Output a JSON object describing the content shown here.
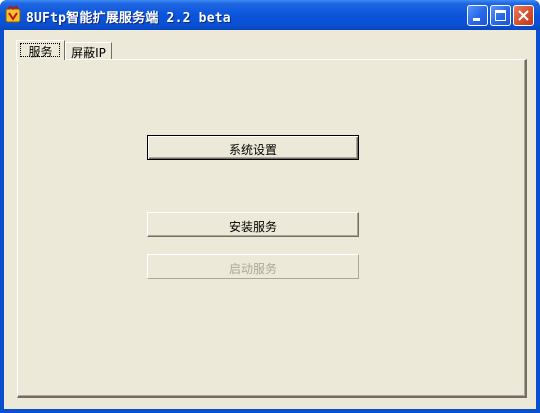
{
  "window": {
    "title": "8UFtp智能扩展服务端 2.2 beta",
    "icon": "app-icon",
    "controls": {
      "minimize": "minimize-icon",
      "maximize": "maximize-icon",
      "close": "close-icon"
    }
  },
  "tabs": [
    {
      "label": "服务",
      "selected": true
    },
    {
      "label": "屏蔽IP",
      "selected": false
    }
  ],
  "buttons": {
    "system_settings": "系统设置",
    "install_service": "安装服务",
    "start_service": "启动服务"
  },
  "colors": {
    "titlebar": "#0a4fd0",
    "face": "#ece9d8",
    "close": "#d4502e",
    "disabled_text": "#aca899"
  }
}
